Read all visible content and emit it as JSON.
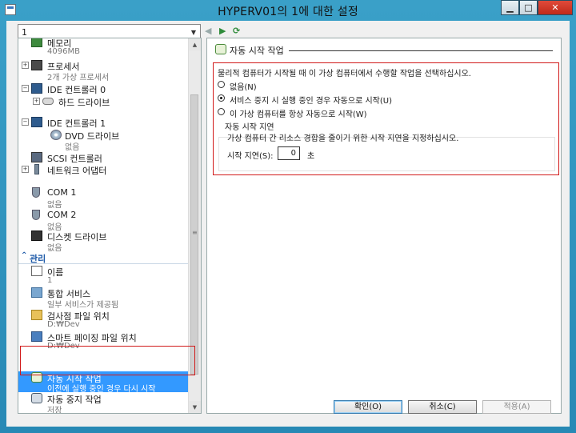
{
  "window": {
    "title": "HYPERV01의 1에 대한 설정",
    "min_label": "▁",
    "max_label": "□",
    "close_label": "✕"
  },
  "vm_selector": {
    "value": "1"
  },
  "tree": {
    "memory": {
      "label": "메모리",
      "sub": "4096MB"
    },
    "processor": {
      "label": "프로세서",
      "sub": "2개 가상 프로세서"
    },
    "ide0": {
      "label": "IDE 컨트롤러 0"
    },
    "hdd": {
      "label": "하드 드라이브"
    },
    "ide1": {
      "label": "IDE 컨트롤러 1"
    },
    "dvd": {
      "label": "DVD 드라이브",
      "sub": "없음"
    },
    "scsi": {
      "label": "SCSI 컨트롤러"
    },
    "network": {
      "label": "네트워크 어댑터"
    },
    "com1": {
      "label": "COM 1",
      "sub": "없음"
    },
    "com2": {
      "label": "COM 2",
      "sub": "없음"
    },
    "floppy": {
      "label": "디스켓 드라이브",
      "sub": "없음"
    },
    "management_header": "관리",
    "name": {
      "label": "이름",
      "sub": "1"
    },
    "integration": {
      "label": "통합 서비스",
      "sub": "일부 서비스가 제공됨"
    },
    "checkpoint": {
      "label": "검사점 파일 위치",
      "sub": "D:₩Dev"
    },
    "paging": {
      "label": "스마트 페이징 파일 위치",
      "sub": "D:₩Dev"
    },
    "auto_start": {
      "label": "자동 시작 작업",
      "sub": "이전에 실행 중인 경우 다시 시작"
    },
    "auto_stop": {
      "label": "자동 중지 작업",
      "sub": "저장"
    }
  },
  "details": {
    "title": "자동 시작 작업",
    "prompt": "물리적 컴퓨터가 시작될 때 이 가상 컴퓨터에서 수행할 작업을 선택하십시오.",
    "options": [
      {
        "label": "없음(N)",
        "checked": false
      },
      {
        "label": "서비스 중지 시 실행 중인 경우 자동으로 시작(U)",
        "checked": true
      },
      {
        "label": "이 가상 컴퓨터를 항상 자동으로 시작(W)",
        "checked": false
      }
    ],
    "delay_group_label": "자동 시작 지연",
    "delay_desc": "가상 컴퓨터 간 리소스 경합을 줄이기 위한 시작 지연을 지정하십시오.",
    "delay_label": "시작 지연(S):",
    "delay_value": "0",
    "delay_unit": "초"
  },
  "buttons": {
    "ok": "확인(O)",
    "cancel": "취소(C)",
    "apply": "적용(A)"
  },
  "colors": {
    "accent": "#3399ff",
    "highlight_box": "#d11a1a",
    "section_header": "#1e5aa8"
  }
}
